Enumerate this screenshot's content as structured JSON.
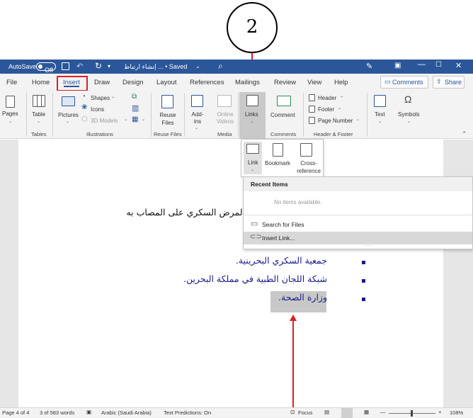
{
  "annotation": {
    "step_number": "2"
  },
  "titlebar": {
    "autosave_label": "AutoSave",
    "autosave_state": "Off",
    "doc_title": "إنشاء ارتباط ... • Saved",
    "colors": {
      "bar": "#2b579a"
    }
  },
  "tabs": [
    "File",
    "Home",
    "Insert",
    "Draw",
    "Design",
    "Layout",
    "References",
    "Mailings",
    "Review",
    "View",
    "Help"
  ],
  "active_tab": "Insert",
  "actions": {
    "comments_label": "Comments",
    "share_label": "Share"
  },
  "ribbon": {
    "pages_label": "Pages",
    "table_label": "Table",
    "pictures_label": "Pictures",
    "shapes_label": "Shapes",
    "icons_label": "Icons",
    "models_label": "3D Models",
    "reuse_files_label": "Reuse Files",
    "addins_label": "Add-ins",
    "online_videos_label": "Online Videos",
    "links_label": "Links",
    "comment_label": "Comment",
    "header_label": "Header",
    "footer_label": "Footer",
    "page_number_label": "Page Number",
    "text_label": "Text",
    "symbols_label": "Symbols",
    "groups": {
      "tables": "Tables",
      "illustrations": "Illustrations",
      "reuse_files": "Reuse Files",
      "media": "Media",
      "comments": "Comments",
      "header_footer": "Header & Footer"
    }
  },
  "links_dropdown": {
    "link_label": "Link",
    "bookmark_label": "Bookmark",
    "cross_reference_label": "Cross-reference",
    "recent_items_label": "Recent Items",
    "no_items_label": "No items available.",
    "search_files_label": "Search for Files",
    "insert_link_label": "Insert Link..."
  },
  "document": {
    "line1": "المرض السكري على المصاب به",
    "bullets": [
      "جمعية السكري البحرينية.",
      "شبكة اللجان الطبية في مملكة البحرين.",
      "وزارة الصحة."
    ],
    "colors": {
      "bullet_text": "#1a1a8c",
      "selection": "#c8c8c8"
    }
  },
  "statusbar": {
    "page": "Page 4 of 4",
    "words": "3 of 583 words",
    "language": "Arabic (Saudi Arabia)",
    "text_predictions": "Text Predictions: On",
    "focus": "Focus",
    "zoom": "108%"
  }
}
